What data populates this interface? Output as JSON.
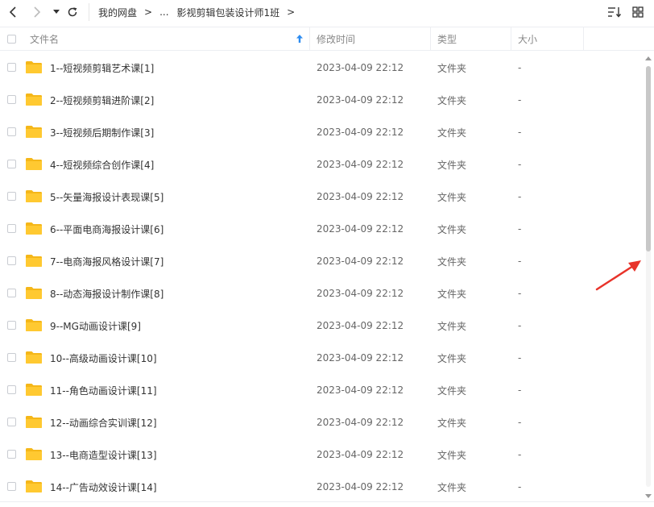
{
  "toolbar": {
    "back_icon": "chevron-left-icon",
    "forward_icon": "chevron-right-icon",
    "dropdown_icon": "caret-down-icon",
    "refresh_icon": "refresh-icon",
    "sort_icon": "sort-icon",
    "grid_view_icon": "grid-view-icon"
  },
  "breadcrumb": {
    "root": "我的网盘",
    "separator": ">",
    "ellipsis": "...",
    "current": "影视剪辑包装设计师1班",
    "trailing_separator": ">"
  },
  "header": {
    "name": "文件名",
    "modified": "修改时间",
    "type": "类型",
    "size": "大小",
    "sort_indicator": "↑"
  },
  "files": [
    {
      "name": "1--短视频剪辑艺术课[1]",
      "modified": "2023-04-09 22:12",
      "type": "文件夹",
      "size": "-"
    },
    {
      "name": "2--短视频剪辑进阶课[2]",
      "modified": "2023-04-09 22:12",
      "type": "文件夹",
      "size": "-"
    },
    {
      "name": "3--短视频后期制作课[3]",
      "modified": "2023-04-09 22:12",
      "type": "文件夹",
      "size": "-"
    },
    {
      "name": "4--短视频综合创作课[4]",
      "modified": "2023-04-09 22:12",
      "type": "文件夹",
      "size": "-"
    },
    {
      "name": "5--矢量海报设计表现课[5]",
      "modified": "2023-04-09 22:12",
      "type": "文件夹",
      "size": "-"
    },
    {
      "name": "6--平面电商海报设计课[6]",
      "modified": "2023-04-09 22:12",
      "type": "文件夹",
      "size": "-"
    },
    {
      "name": "7--电商海报风格设计课[7]",
      "modified": "2023-04-09 22:12",
      "type": "文件夹",
      "size": "-"
    },
    {
      "name": "8--动态海报设计制作课[8]",
      "modified": "2023-04-09 22:12",
      "type": "文件夹",
      "size": "-"
    },
    {
      "name": "9--MG动画设计课[9]",
      "modified": "2023-04-09 22:12",
      "type": "文件夹",
      "size": "-"
    },
    {
      "name": "10--高级动画设计课[10]",
      "modified": "2023-04-09 22:12",
      "type": "文件夹",
      "size": "-"
    },
    {
      "name": "11--角色动画设计课[11]",
      "modified": "2023-04-09 22:12",
      "type": "文件夹",
      "size": "-"
    },
    {
      "name": "12--动画综合实训课[12]",
      "modified": "2023-04-09 22:12",
      "type": "文件夹",
      "size": "-"
    },
    {
      "name": "13--电商造型设计课[13]",
      "modified": "2023-04-09 22:12",
      "type": "文件夹",
      "size": "-"
    },
    {
      "name": "14--广告动效设计课[14]",
      "modified": "2023-04-09 22:12",
      "type": "文件夹",
      "size": "-"
    }
  ],
  "scrollbar": {
    "scroll_position_fraction": 0.0,
    "visible_fraction": 0.44
  },
  "colors": {
    "folder": "#FFC931",
    "folder_tab": "#F5B719",
    "sort_arrow": "#2d8cf0",
    "annotation_arrow": "#e8332a"
  },
  "annotation": {
    "icon": "red-arrow-icon"
  }
}
